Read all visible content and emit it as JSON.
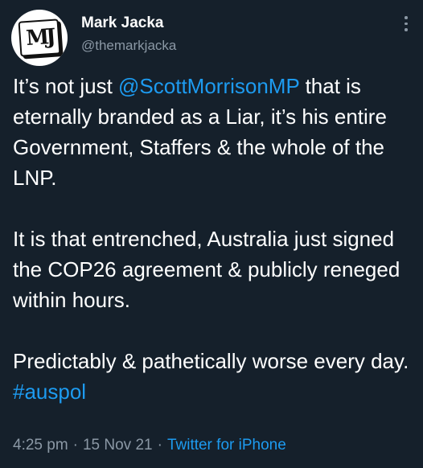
{
  "author": {
    "name": "Mark Jacka",
    "handle": "@themarkjacka",
    "avatar_text": "MJ"
  },
  "body": {
    "p1_pre": "It’s not just ",
    "p1_mention": "@ScottMorrisonMP",
    "p1_post": " that is eternally branded as a Liar, it’s his entire Government, Staffers & the whole of the LNP.",
    "p2": "It is that entrenched, Australia just signed the COP26 agreement & publicly reneged within hours.",
    "p3": "Predictably & pathetically worse every day.",
    "hashtag": "#auspol"
  },
  "meta": {
    "time": "4:25 pm",
    "date": "15 Nov 21",
    "separator": "·",
    "source": "Twitter for iPhone"
  },
  "colors": {
    "background": "#15202b",
    "link": "#1d9bf0",
    "secondary_text": "#8b98a5"
  },
  "icons": {
    "more": "more-vertical-icon"
  }
}
